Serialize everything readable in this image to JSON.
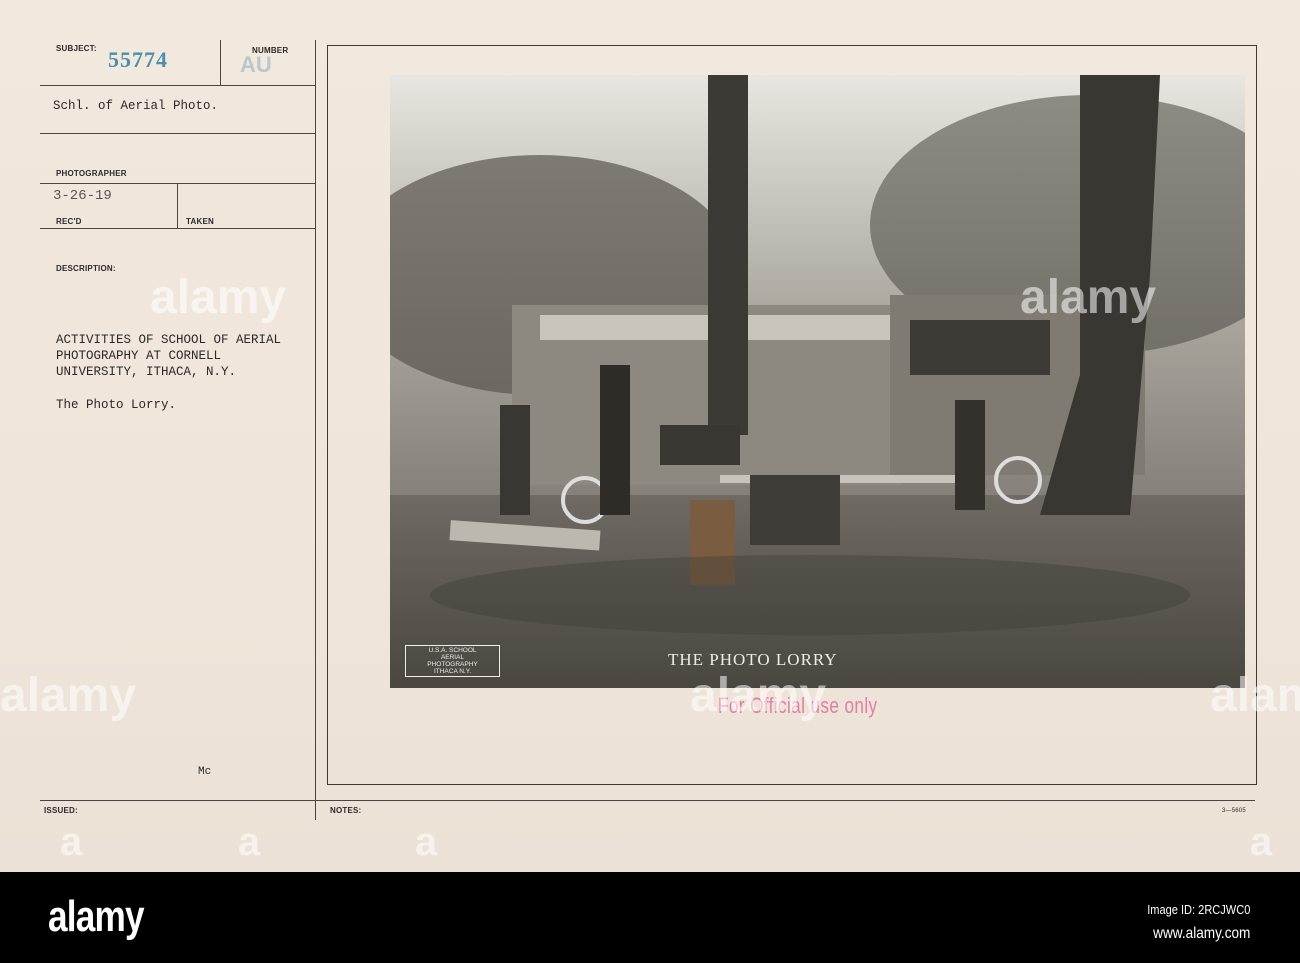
{
  "card": {
    "subject_label": "SUBJECT:",
    "subject_number": "55774",
    "number_label": "NUMBER",
    "number_stamp": "AU",
    "subject_text": "Schl. of Aerial Photo.",
    "photographer_label": "PHOTOGRAPHER",
    "recd_date": "3-26-19",
    "recd_label": "REC'D",
    "taken_label": "TAKEN",
    "description_label": "DESCRIPTION:",
    "description_lines": [
      "ACTIVITIES OF SCHOOL OF AERIAL",
      "PHOTOGRAPHY AT CORNELL",
      "UNIVERSITY, ITHACA, N.Y."
    ],
    "photo_title": "The Photo Lorry.",
    "initials": "Mc",
    "issued_label": "ISSUED:",
    "notes_label": "NOTES:",
    "form_number": "3—5605"
  },
  "photo": {
    "caption": "THE PHOTO  LORRY",
    "logo_text": [
      "U.S.A. SCHOOL",
      "AERIAL",
      "PHOTOGRAPHY",
      "ITHACA N.Y."
    ],
    "stamp": "For Official use only"
  },
  "watermark": {
    "text": "alamy",
    "letter": "a"
  },
  "footer": {
    "brand": "alamy",
    "image_id": "Image ID: 2RCJWC0",
    "website": "www.alamy.com"
  }
}
